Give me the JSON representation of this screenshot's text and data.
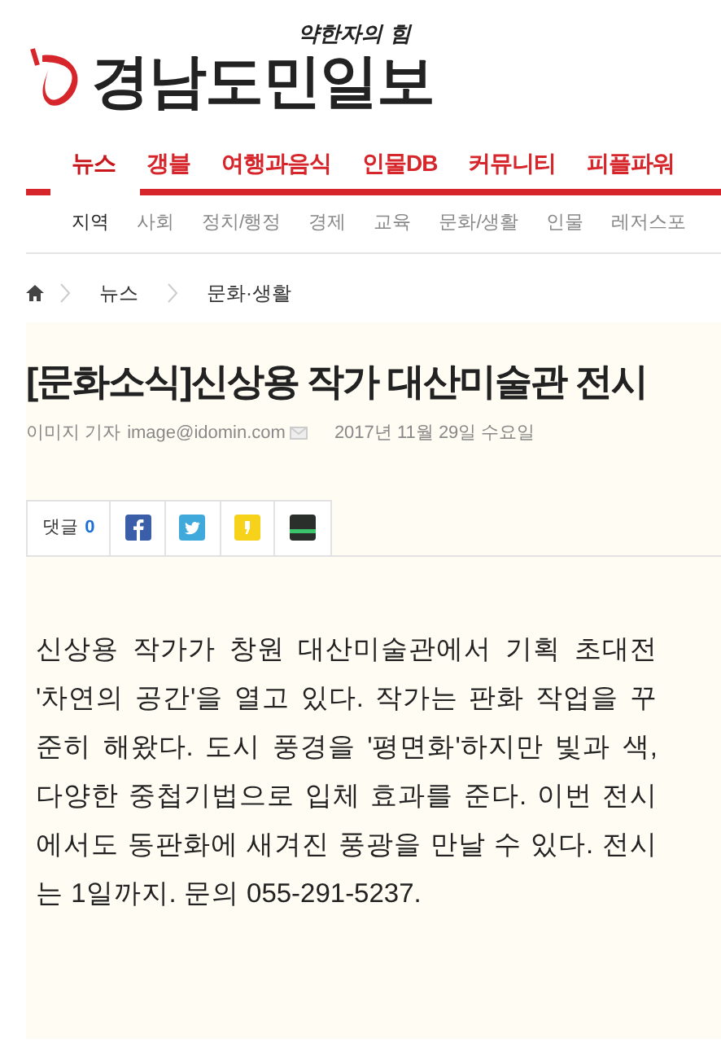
{
  "logo": {
    "slogan": "약한자의 힘",
    "name": "경남도민일보"
  },
  "main_nav": [
    {
      "label": "뉴스",
      "selected": true
    },
    {
      "label": "갱블",
      "selected": false
    },
    {
      "label": "여행과음식",
      "selected": false
    },
    {
      "label": "인물DB",
      "selected": false
    },
    {
      "label": "커뮤니티",
      "selected": false
    },
    {
      "label": "피플파워",
      "selected": false
    }
  ],
  "sub_nav": [
    {
      "label": "지역",
      "selected": true
    },
    {
      "label": "사회",
      "selected": false
    },
    {
      "label": "정치/행정",
      "selected": false
    },
    {
      "label": "경제",
      "selected": false
    },
    {
      "label": "교육",
      "selected": false
    },
    {
      "label": "문화/생활",
      "selected": false
    },
    {
      "label": "인물",
      "selected": false
    },
    {
      "label": "레저스포",
      "selected": false
    }
  ],
  "breadcrumb": [
    "뉴스",
    "문화·생활"
  ],
  "article": {
    "title": "[문화소식]신상용 작가 대산미술관 전시",
    "reporter": "이미지 기자",
    "email": "image@idomin.com",
    "date": "2017년 11월 29일 수요일",
    "share": {
      "comments_label": "댓글",
      "comments_count": "0",
      "buttons": [
        {
          "kind": "facebook"
        },
        {
          "kind": "twitter"
        },
        {
          "kind": "kakaostory"
        },
        {
          "kind": "band"
        }
      ]
    },
    "body": "신상용 작가가 창원 대산미술관에서 기획 초대전 '차연의 공간'을 열고 있다. 작가는 판화 작업을 꾸준히 해왔다. 도시 풍경을 '평면화'하지만 빛과 색, 다양한 중첩기법으로 입체 효과를 준다. 이번 전시에서도 동판화에 새겨진 풍광을 만날 수 있다. 전시는 1일까지. 문의 055-291-5237."
  }
}
